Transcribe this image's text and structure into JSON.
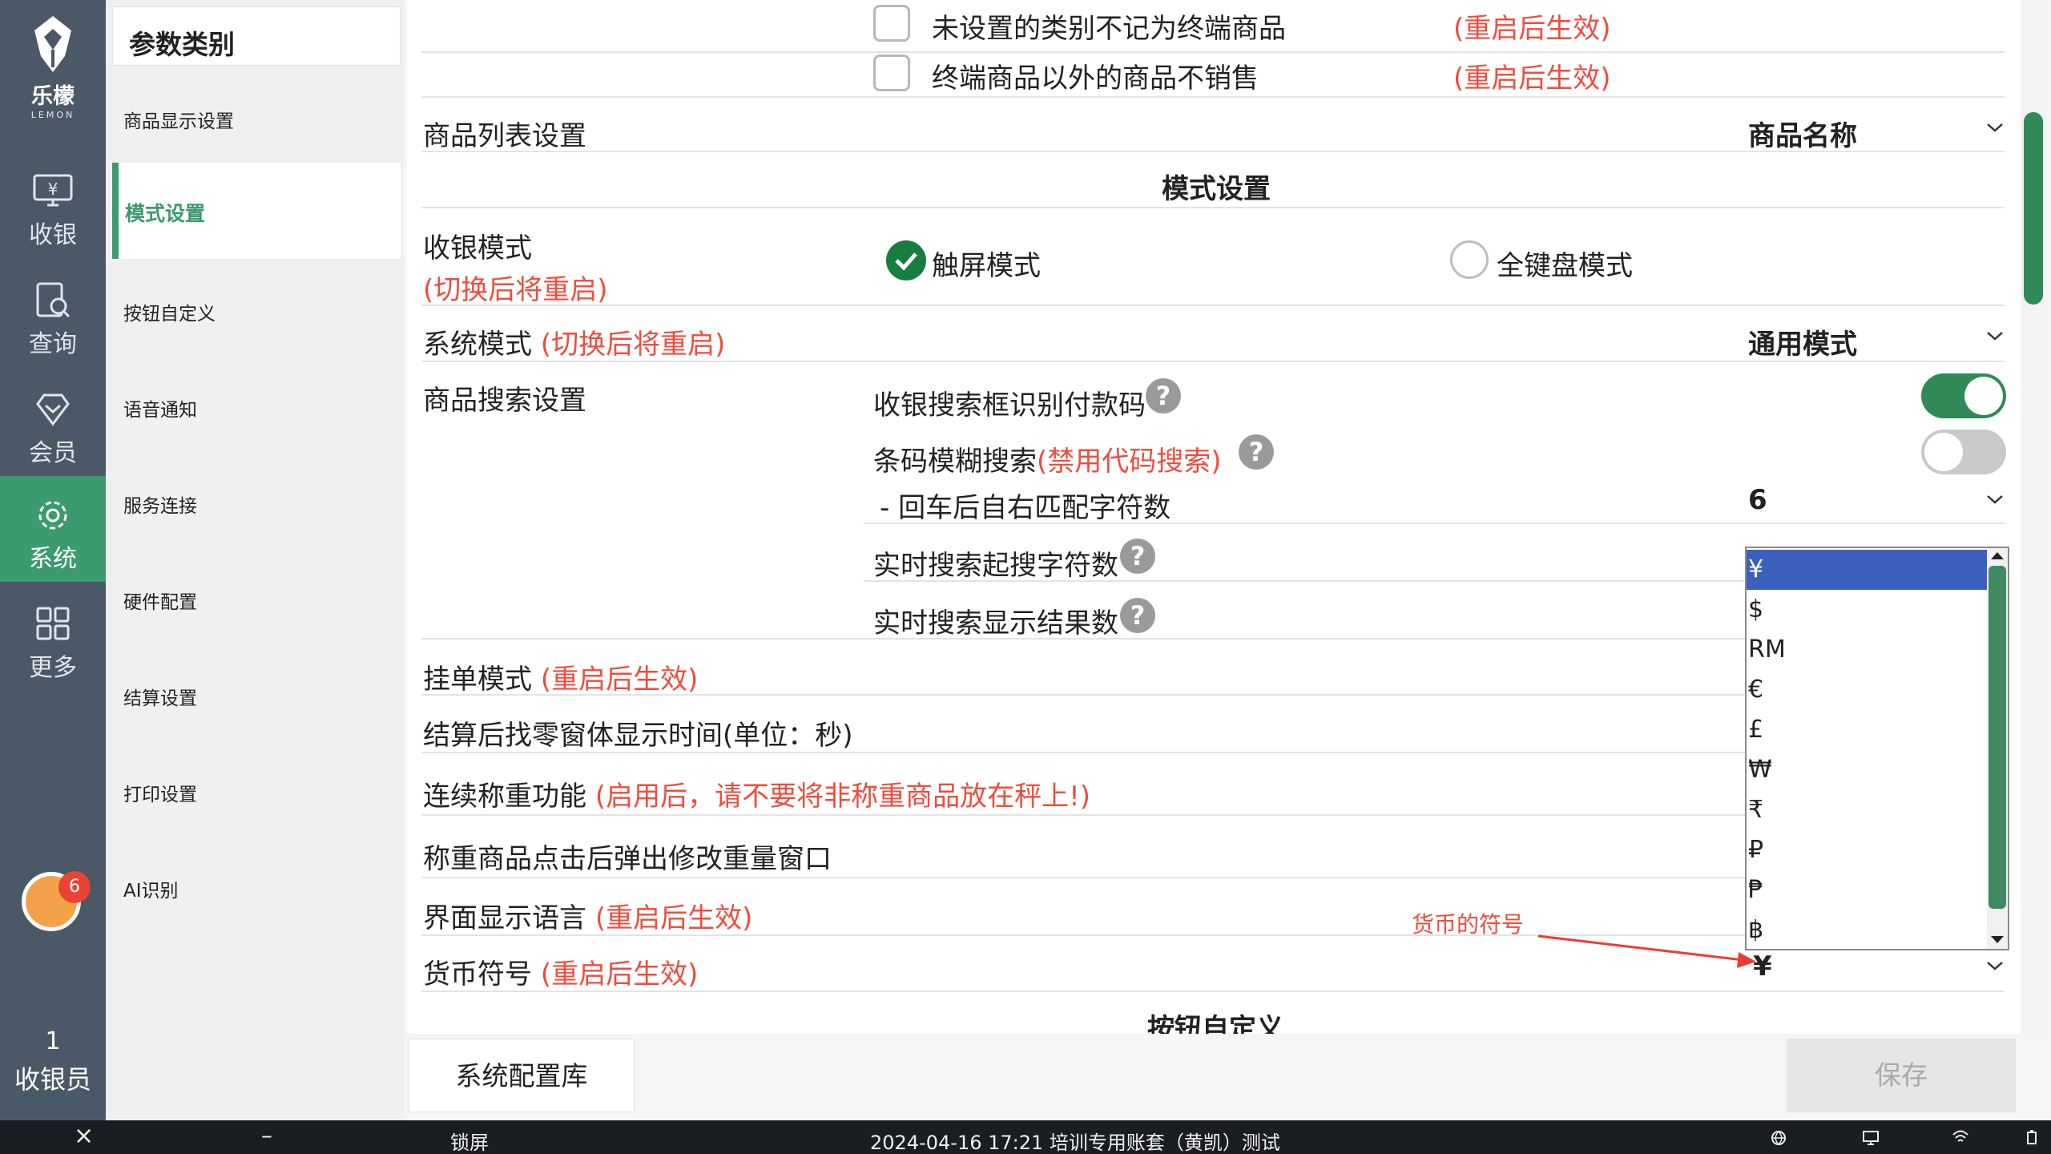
{
  "brand": {
    "name_cn": "乐檬",
    "name_en": "LEMON"
  },
  "nav": [
    {
      "label": "收银",
      "icon": "cashier-icon"
    },
    {
      "label": "查询",
      "icon": "search-doc-icon"
    },
    {
      "label": "会员",
      "icon": "member-icon"
    },
    {
      "label": "系统",
      "icon": "gear-icon",
      "active": true
    },
    {
      "label": "更多",
      "icon": "grid-icon"
    }
  ],
  "notification_count": "6",
  "cashier": {
    "count": "1",
    "label": "收银员"
  },
  "categories": {
    "header": "参数类别",
    "items": [
      "商品显示设置",
      "模式设置",
      "按钮自定义",
      "语音通知",
      "服务连接",
      "硬件配置",
      "结算设置",
      "打印设置",
      "AI识别"
    ],
    "active_index": 1
  },
  "main": {
    "cb1": {
      "label": "未设置的类别不记为终端商品",
      "note": "(重启后生效)"
    },
    "cb2": {
      "label": "终端商品以外的商品不销售",
      "note": "(重启后生效)"
    },
    "product_list": {
      "label": "商品列表设置",
      "value": "商品名称"
    },
    "section_mode": "模式设置",
    "cashier_mode": {
      "label": "收银模式",
      "note": "(切换后将重启)",
      "opt1": "触屏模式",
      "opt2": "全键盘模式"
    },
    "system_mode": {
      "label": "系统模式",
      "note": "(切换后将重启)",
      "value": "通用模式"
    },
    "search": {
      "label": "商品搜索设置",
      "pay_code": "收银搜索框识别付款码",
      "barcode_fuzzy": "条码模糊搜索",
      "barcode_note": "(禁用代码搜索)",
      "enter_match": "- 回车后自右匹配字符数",
      "enter_match_value": "6",
      "realtime_start": "实时搜索起搜字符数",
      "realtime_results": "实时搜索显示结果数"
    },
    "hold_mode": {
      "label": "挂单模式",
      "note": "(重启后生效)"
    },
    "change_time": {
      "label": "结算后找零窗体显示时间(单位：秒)"
    },
    "weigh": {
      "label": "连续称重功能",
      "note": "(启用后，请不要将非称重商品放在秤上!)"
    },
    "weigh_popup": {
      "label": "称重商品点击后弹出修改重量窗口"
    },
    "language": {
      "label": "界面显示语言",
      "note": "(重启后生效)"
    },
    "currency": {
      "label": "货币符号",
      "note": "(重启后生效)",
      "value": "¥",
      "annotation": "货币的符号"
    },
    "section_buttons": "按钮自定义"
  },
  "currency_options": [
    "¥",
    "$",
    "RM",
    "€",
    "£",
    "₩",
    "₹",
    "₽",
    "₱",
    "฿"
  ],
  "buttons": {
    "config_lib": "系统配置库",
    "save": "保存"
  },
  "taskbar": {
    "lock": "锁屏",
    "status": "2024-04-16 17:21 培训专用账套（黄凯）测试"
  },
  "colors": {
    "accent": "#3b9a6e",
    "nav_bg": "#4b5868",
    "warn": "#ef4c3e",
    "select": "#3b5fbc"
  }
}
